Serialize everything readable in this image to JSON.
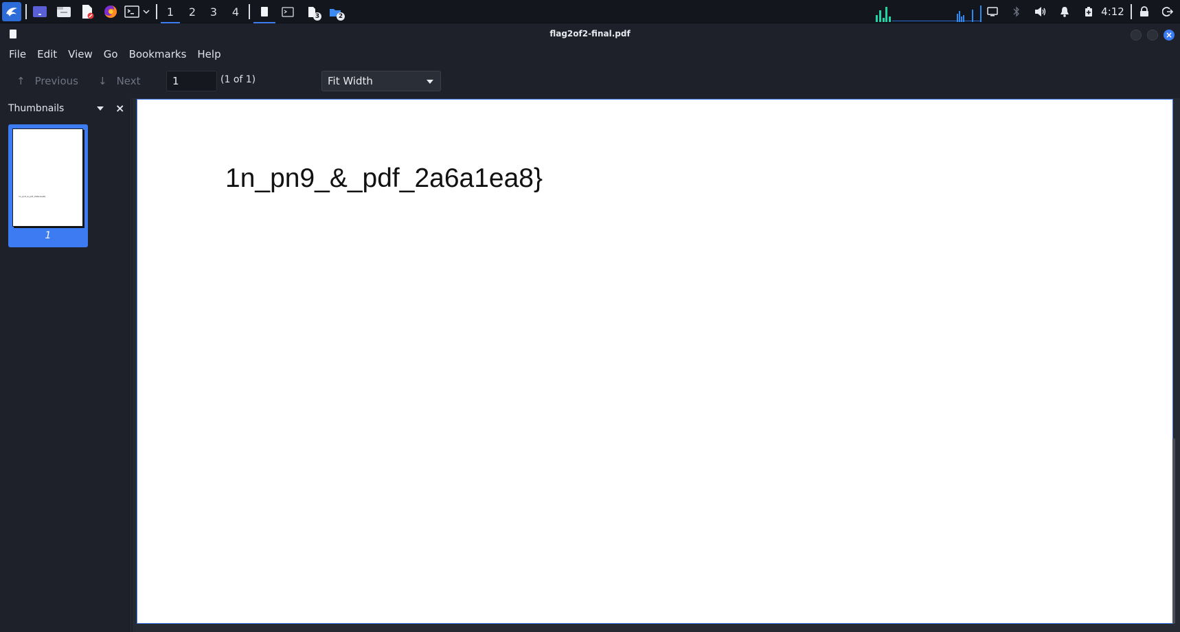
{
  "taskbar": {
    "workspaces": [
      "1",
      "2",
      "3",
      "4"
    ],
    "active_workspace": "1",
    "task_badges": [
      "3",
      "2"
    ],
    "clock": "4:12"
  },
  "window": {
    "title": "flag2of2-final.pdf"
  },
  "menu": [
    "File",
    "Edit",
    "View",
    "Go",
    "Bookmarks",
    "Help"
  ],
  "toolbar": {
    "previous_label": "Previous",
    "next_label": "Next",
    "page_value": "1",
    "page_count": "(1 of 1)",
    "zoom_value": "Fit Width"
  },
  "sidebar": {
    "title": "Thumbnails",
    "thumbnail_number": "1",
    "thumbnail_text": "1n_pn9_&_pdf_2a6a1ea8}"
  },
  "document": {
    "text": "1n_pn9_&_pdf_2a6a1ea8}"
  },
  "colors": {
    "accent": "#3d7bf2",
    "panel": "#13161c",
    "window_bg": "#1e2129",
    "page": "#ffffff"
  },
  "icons": [
    "kali-dragon-icon",
    "workspace-desktop-icon",
    "file-manager-icon",
    "text-editor-icon",
    "firefox-icon",
    "terminal-icon",
    "chevron-down-icon",
    "document-icon",
    "terminal-window-icon",
    "document-stack-icon",
    "folder-stack-icon",
    "network-graph-icon",
    "display-icon",
    "bluetooth-icon",
    "volume-icon",
    "bell-icon",
    "battery-icon",
    "lock-icon",
    "logout-icon",
    "arrow-up-icon",
    "arrow-down-icon",
    "close-icon"
  ]
}
